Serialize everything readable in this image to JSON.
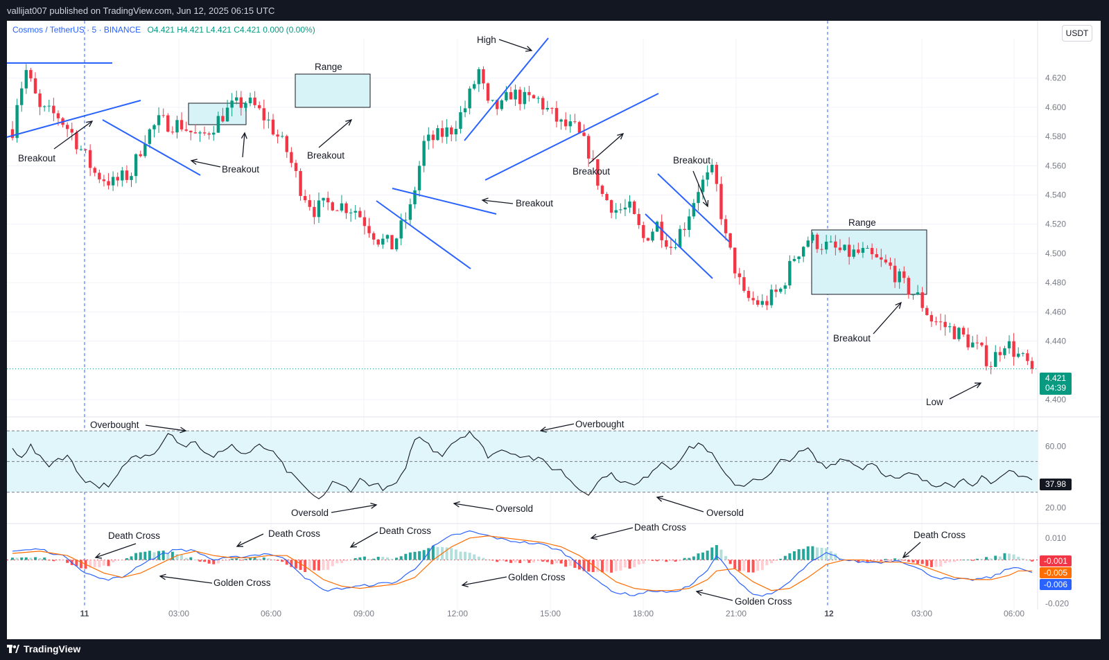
{
  "publisher_line": "vallijat007 published on TradingView.com, Jun 12, 2025 06:15 UTC",
  "footer_brand": "TradingView",
  "symbol": {
    "name": "Cosmos / TetherUS · 5 · BINANCE",
    "ohlc": "O4.421  H4.421  L4.421  C4.421  0.000 (0.00%)",
    "currency": "USDT",
    "last_price": "4.421",
    "countdown": "04:39"
  },
  "colors": {
    "up": "#089981",
    "down": "#f23645",
    "trendline": "#2962ff",
    "macd_line": "#2962ff",
    "signal_line": "#ff6d00",
    "box_fill": "#d8f3f8",
    "rsi_band": "#e0f6fa"
  },
  "chart_data": [
    {
      "type": "candlestick",
      "title": "Cosmos / TetherUS · 5 · BINANCE",
      "ylim": [
        4.39,
        4.645
      ],
      "y_ticks": [
        "4.620",
        "4.600",
        "4.580",
        "4.560",
        "4.540",
        "4.520",
        "4.500",
        "4.480",
        "4.460",
        "4.440",
        "4.400"
      ],
      "x_ticks": [
        "11",
        "03:00",
        "06:00",
        "09:00",
        "12:00",
        "15:00",
        "18:00",
        "21:00",
        "12",
        "03:00",
        "06:00"
      ],
      "anchors": [
        [
          0,
          4.585
        ],
        [
          1,
          4.605
        ],
        [
          3,
          4.625
        ],
        [
          6,
          4.598
        ],
        [
          10,
          4.594
        ],
        [
          13,
          4.582
        ],
        [
          18,
          4.555
        ],
        [
          22,
          4.548
        ],
        [
          26,
          4.555
        ],
        [
          29,
          4.58
        ],
        [
          32,
          4.59
        ],
        [
          37,
          4.588
        ],
        [
          41,
          4.578
        ],
        [
          44,
          4.588
        ],
        [
          46,
          4.595
        ],
        [
          48,
          4.6
        ],
        [
          51,
          4.604
        ],
        [
          53,
          4.6
        ],
        [
          56,
          4.59
        ],
        [
          60,
          4.57
        ],
        [
          63,
          4.545
        ],
        [
          66,
          4.53
        ],
        [
          70,
          4.535
        ],
        [
          75,
          4.53
        ],
        [
          80,
          4.51
        ],
        [
          83,
          4.505
        ],
        [
          87,
          4.53
        ],
        [
          90,
          4.575
        ],
        [
          93,
          4.58
        ],
        [
          96,
          4.585
        ],
        [
          99,
          4.6
        ],
        [
          102,
          4.625
        ],
        [
          104,
          4.6
        ],
        [
          107,
          4.6
        ],
        [
          109,
          4.61
        ],
        [
          112,
          4.605
        ],
        [
          115,
          4.605
        ],
        [
          117,
          4.598
        ],
        [
          120,
          4.588
        ],
        [
          123,
          4.585
        ],
        [
          126,
          4.57
        ],
        [
          129,
          4.54
        ],
        [
          132,
          4.53
        ],
        [
          135,
          4.53
        ],
        [
          138,
          4.51
        ],
        [
          141,
          4.52
        ],
        [
          144,
          4.505
        ],
        [
          147,
          4.52
        ],
        [
          150,
          4.545
        ],
        [
          153,
          4.555
        ],
        [
          154,
          4.545
        ],
        [
          156,
          4.51
        ],
        [
          160,
          4.47
        ],
        [
          164,
          4.465
        ],
        [
          168,
          4.475
        ],
        [
          171,
          4.498
        ],
        [
          174,
          4.51
        ],
        [
          178,
          4.505
        ],
        [
          182,
          4.5
        ],
        [
          186,
          4.5
        ],
        [
          189,
          4.495
        ],
        [
          192,
          4.49
        ],
        [
          195,
          4.478
        ],
        [
          198,
          4.47
        ],
        [
          201,
          4.455
        ],
        [
          204,
          4.45
        ],
        [
          207,
          4.445
        ],
        [
          211,
          4.435
        ],
        [
          214,
          4.425
        ],
        [
          217,
          4.44
        ],
        [
          220,
          4.43
        ],
        [
          223,
          4.421
        ]
      ],
      "rsi": {
        "ylim": [
          10,
          80
        ],
        "levels": [
          70,
          50,
          30
        ],
        "y_ticks": [
          "60.00",
          "20.00"
        ],
        "value": "37.98",
        "anchors": [
          [
            0,
            58
          ],
          [
            2,
            54
          ],
          [
            4,
            60
          ],
          [
            6,
            52
          ],
          [
            8,
            48
          ],
          [
            10,
            52
          ],
          [
            12,
            54
          ],
          [
            14,
            44
          ],
          [
            16,
            38
          ],
          [
            19,
            34
          ],
          [
            22,
            36
          ],
          [
            24,
            45
          ],
          [
            26,
            52
          ],
          [
            28,
            53
          ],
          [
            30,
            54
          ],
          [
            32,
            60
          ],
          [
            34,
            70
          ],
          [
            36,
            64
          ],
          [
            38,
            60
          ],
          [
            40,
            64
          ],
          [
            42,
            55
          ],
          [
            44,
            52
          ],
          [
            46,
            58
          ],
          [
            48,
            61
          ],
          [
            50,
            55
          ],
          [
            52,
            56
          ],
          [
            54,
            60
          ],
          [
            56,
            58
          ],
          [
            58,
            52
          ],
          [
            60,
            44
          ],
          [
            62,
            38
          ],
          [
            64,
            33
          ],
          [
            66,
            26
          ],
          [
            68,
            28
          ],
          [
            70,
            36
          ],
          [
            72,
            34
          ],
          [
            74,
            32
          ],
          [
            76,
            38
          ],
          [
            78,
            36
          ],
          [
            80,
            34
          ],
          [
            82,
            32
          ],
          [
            84,
            36
          ],
          [
            86,
            44
          ],
          [
            88,
            66
          ],
          [
            90,
            64
          ],
          [
            92,
            58
          ],
          [
            94,
            55
          ],
          [
            96,
            62
          ],
          [
            98,
            66
          ],
          [
            100,
            70
          ],
          [
            102,
            62
          ],
          [
            104,
            54
          ],
          [
            106,
            56
          ],
          [
            108,
            58
          ],
          [
            110,
            55
          ],
          [
            112,
            54
          ],
          [
            114,
            52
          ],
          [
            116,
            50
          ],
          [
            118,
            46
          ],
          [
            120,
            44
          ],
          [
            122,
            38
          ],
          [
            124,
            32
          ],
          [
            126,
            30
          ],
          [
            128,
            36
          ],
          [
            130,
            42
          ],
          [
            132,
            40
          ],
          [
            134,
            36
          ],
          [
            136,
            34
          ],
          [
            138,
            38
          ],
          [
            140,
            45
          ],
          [
            142,
            50
          ],
          [
            144,
            46
          ],
          [
            146,
            52
          ],
          [
            148,
            58
          ],
          [
            150,
            62
          ],
          [
            152,
            58
          ],
          [
            154,
            50
          ],
          [
            156,
            40
          ],
          [
            158,
            36
          ],
          [
            160,
            34
          ],
          [
            162,
            40
          ],
          [
            164,
            37
          ],
          [
            166,
            42
          ],
          [
            168,
            50
          ],
          [
            170,
            52
          ],
          [
            172,
            55
          ],
          [
            174,
            58
          ],
          [
            176,
            50
          ],
          [
            178,
            46
          ],
          [
            180,
            50
          ],
          [
            182,
            53
          ],
          [
            184,
            48
          ],
          [
            186,
            46
          ],
          [
            188,
            50
          ],
          [
            190,
            44
          ],
          [
            192,
            40
          ],
          [
            194,
            38
          ],
          [
            196,
            42
          ],
          [
            198,
            40
          ],
          [
            200,
            36
          ],
          [
            202,
            34
          ],
          [
            204,
            38
          ],
          [
            206,
            35
          ],
          [
            208,
            38
          ],
          [
            210,
            36
          ],
          [
            212,
            40
          ],
          [
            214,
            34
          ],
          [
            216,
            38
          ],
          [
            218,
            44
          ],
          [
            220,
            42
          ],
          [
            222,
            40
          ],
          [
            223,
            37.98
          ]
        ]
      },
      "macd": {
        "ylim": [
          -0.022,
          0.016
        ],
        "y_ticks": [
          "0.010",
          "-0.020"
        ],
        "values": {
          "macd": "-0.006",
          "signal": "-0.005",
          "histogram": "-0.001"
        },
        "macd_anchors": [
          [
            0,
            0.004
          ],
          [
            6,
            0.005
          ],
          [
            12,
            0.001
          ],
          [
            16,
            -0.006
          ],
          [
            20,
            -0.009
          ],
          [
            24,
            -0.008
          ],
          [
            28,
            -0.002
          ],
          [
            32,
            0.002
          ],
          [
            36,
            0.005
          ],
          [
            40,
            0.004
          ],
          [
            44,
            0.0
          ],
          [
            48,
            0.001
          ],
          [
            52,
            0.002
          ],
          [
            56,
            0.003
          ],
          [
            60,
            0.0
          ],
          [
            64,
            -0.008
          ],
          [
            68,
            -0.014
          ],
          [
            72,
            -0.013
          ],
          [
            76,
            -0.012
          ],
          [
            80,
            -0.011
          ],
          [
            84,
            -0.01
          ],
          [
            88,
            -0.004
          ],
          [
            92,
            0.006
          ],
          [
            96,
            0.011
          ],
          [
            100,
            0.013
          ],
          [
            104,
            0.011
          ],
          [
            108,
            0.009
          ],
          [
            112,
            0.008
          ],
          [
            116,
            0.007
          ],
          [
            120,
            0.004
          ],
          [
            124,
            -0.002
          ],
          [
            128,
            -0.01
          ],
          [
            132,
            -0.015
          ],
          [
            136,
            -0.016
          ],
          [
            140,
            -0.014
          ],
          [
            144,
            -0.015
          ],
          [
            148,
            -0.012
          ],
          [
            152,
            -0.005
          ],
          [
            154,
            0.002
          ],
          [
            158,
            -0.008
          ],
          [
            162,
            -0.016
          ],
          [
            166,
            -0.016
          ],
          [
            170,
            -0.01
          ],
          [
            174,
            -0.002
          ],
          [
            178,
            0.003
          ],
          [
            182,
            0.0
          ],
          [
            186,
            -0.001
          ],
          [
            190,
            -0.001
          ],
          [
            194,
            0.0
          ],
          [
            198,
            -0.004
          ],
          [
            202,
            -0.008
          ],
          [
            206,
            -0.009
          ],
          [
            210,
            -0.009
          ],
          [
            214,
            -0.008
          ],
          [
            218,
            -0.004
          ],
          [
            220,
            -0.003
          ],
          [
            223,
            -0.006
          ]
        ],
        "signal_anchors": [
          [
            0,
            0.003
          ],
          [
            6,
            0.004
          ],
          [
            12,
            0.002
          ],
          [
            16,
            -0.002
          ],
          [
            20,
            -0.006
          ],
          [
            24,
            -0.008
          ],
          [
            28,
            -0.006
          ],
          [
            32,
            -0.002
          ],
          [
            36,
            0.002
          ],
          [
            40,
            0.004
          ],
          [
            44,
            0.002
          ],
          [
            48,
            0.001
          ],
          [
            52,
            0.001
          ],
          [
            56,
            0.002
          ],
          [
            60,
            0.002
          ],
          [
            64,
            -0.003
          ],
          [
            68,
            -0.009
          ],
          [
            72,
            -0.012
          ],
          [
            76,
            -0.013
          ],
          [
            80,
            -0.012
          ],
          [
            84,
            -0.011
          ],
          [
            88,
            -0.008
          ],
          [
            92,
            0.0
          ],
          [
            96,
            0.006
          ],
          [
            100,
            0.01
          ],
          [
            104,
            0.011
          ],
          [
            108,
            0.01
          ],
          [
            112,
            0.009
          ],
          [
            116,
            0.008
          ],
          [
            120,
            0.006
          ],
          [
            124,
            0.002
          ],
          [
            128,
            -0.004
          ],
          [
            132,
            -0.01
          ],
          [
            136,
            -0.013
          ],
          [
            140,
            -0.014
          ],
          [
            144,
            -0.014
          ],
          [
            148,
            -0.013
          ],
          [
            152,
            -0.009
          ],
          [
            154,
            -0.005
          ],
          [
            158,
            -0.004
          ],
          [
            162,
            -0.01
          ],
          [
            166,
            -0.014
          ],
          [
            170,
            -0.013
          ],
          [
            174,
            -0.008
          ],
          [
            178,
            -0.002
          ],
          [
            182,
            0.0
          ],
          [
            186,
            0.0
          ],
          [
            190,
            -0.001
          ],
          [
            194,
            -0.001
          ],
          [
            198,
            -0.002
          ],
          [
            202,
            -0.005
          ],
          [
            206,
            -0.008
          ],
          [
            210,
            -0.009
          ],
          [
            214,
            -0.009
          ],
          [
            218,
            -0.007
          ],
          [
            220,
            -0.005
          ],
          [
            223,
            -0.005
          ]
        ]
      }
    }
  ],
  "annotations": {
    "price": [
      "Breakout",
      "Breakout",
      "Range",
      "Breakout",
      "High",
      "Breakout",
      "Breakout",
      "Breakout",
      "Range",
      "Breakout",
      "Low"
    ],
    "rsi": [
      "Overbought",
      "Overbought",
      "Oversold",
      "Oversold",
      "Oversold"
    ],
    "macd": [
      "Death Cross",
      "Death Cross",
      "Death Cross",
      "Death Cross",
      "Death Cross",
      "Golden Cross",
      "Golden Cross",
      "Golden Cross"
    ]
  }
}
